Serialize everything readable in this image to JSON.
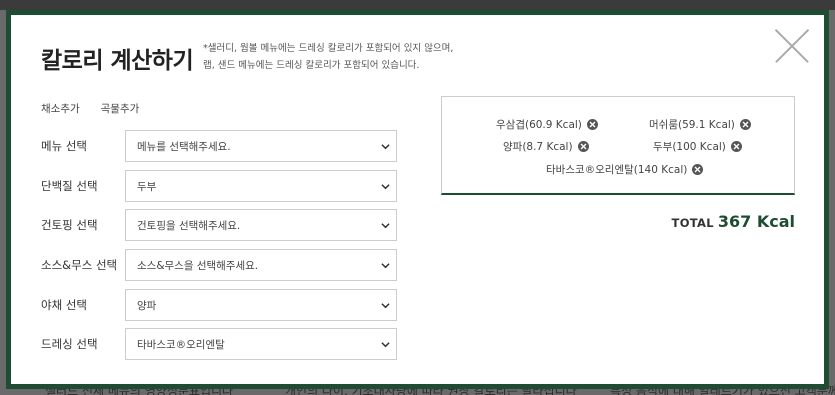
{
  "background": {
    "text_1": "샐러드 전체 메뉴의 영양성분표입니다",
    "text_2": "개인의 나이, 기초대사량에 따라 권장 칼로리는 달라집니다",
    "text_3": "특정 음식에 대해 알레르기가 있으신 고객분께"
  },
  "modal": {
    "title": "칼로리 계산하기",
    "note_line1": "*샐러디, 웜볼 메뉴에는 드레싱 칼로리가 포함되어 있지 않으며,",
    "note_line2": "랩, 샌드 메뉴에는 드레싱 칼로리가 포함되어 있습니다.",
    "close_label": "닫기"
  },
  "tabs": [
    {
      "label": "채소추가"
    },
    {
      "label": "곡물추가"
    }
  ],
  "form": [
    {
      "label": "메뉴 선택",
      "value": "메뉴를 선택해주세요."
    },
    {
      "label": "단백질 선택",
      "value": "두부"
    },
    {
      "label": "건토핑 선택",
      "value": "건토핑을 선택해주세요."
    },
    {
      "label": "소스&무스 선택",
      "value": "소스&무스을 선택해주세요."
    },
    {
      "label": "야채 선택",
      "value": "양파"
    },
    {
      "label": "드레싱 선택",
      "value": "타바스코®오리엔탈"
    }
  ],
  "selected_items": [
    {
      "label": "우삼겹(60.9 Kcal)"
    },
    {
      "label": "머쉬룸(59.1 Kcal)"
    },
    {
      "label": "양파(8.7 Kcal)"
    },
    {
      "label": "두부(100 Kcal)"
    },
    {
      "label": "타바스코®오리엔탈(140 Kcal)"
    }
  ],
  "total": {
    "label": "TOTAL",
    "value": "367 Kcal"
  },
  "colors": {
    "accent": "#1f4d33",
    "remove_icon": "#555555"
  }
}
